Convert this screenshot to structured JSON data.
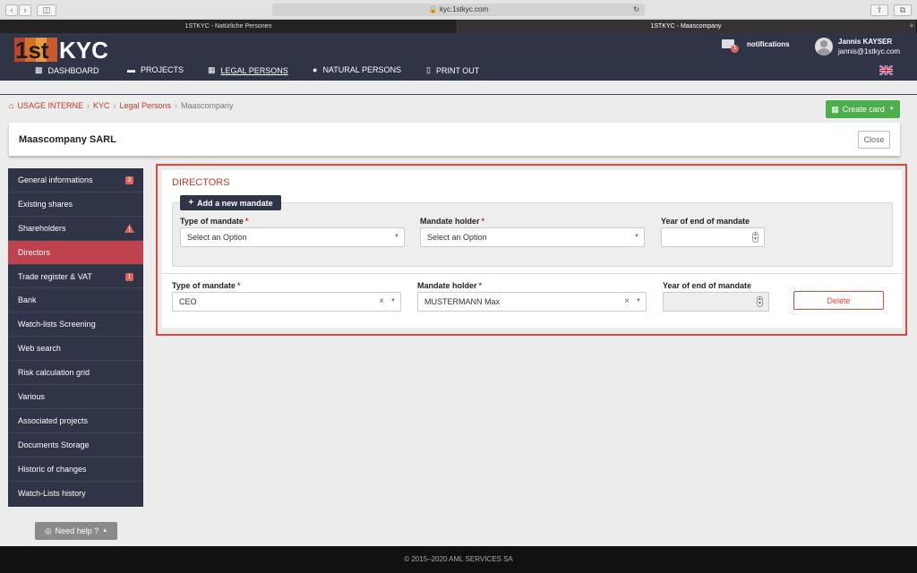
{
  "browser": {
    "url": "kyc.1stkyc.com",
    "tabs": [
      {
        "label": "1STKYC - Natürliche Personen",
        "active": false
      },
      {
        "label": "1STKYC - Maascompany",
        "active": true
      }
    ]
  },
  "header": {
    "logo_text": "1stKYC",
    "notifications_label": "notifications",
    "notification_count": "1",
    "user_name": "Jannis KAYSER",
    "user_email": "jannis@1stkyc.com"
  },
  "nav": {
    "items": [
      {
        "label": "DASHBOARD",
        "icon": "bar-chart-icon"
      },
      {
        "label": "PROJECTS",
        "icon": "folder-icon"
      },
      {
        "label": "LEGAL PERSONS",
        "icon": "building-icon",
        "active": true
      },
      {
        "label": "NATURAL PERSONS",
        "icon": "user-icon"
      },
      {
        "label": "PRINT OUT",
        "icon": "document-icon"
      }
    ],
    "language": "en"
  },
  "breadcrumb": {
    "items": [
      "USAGE INTERNE",
      "KYC",
      "Legal Persons"
    ],
    "current": "Maascompany"
  },
  "create_card_label": "Create card",
  "card": {
    "title": "Maascompany SARL",
    "close_label": "Close"
  },
  "sidebar": {
    "items": [
      {
        "label": "General informations",
        "badge": "3"
      },
      {
        "label": "Existing shares"
      },
      {
        "label": "Shareholders",
        "warning": true
      },
      {
        "label": "Directors",
        "active": true
      },
      {
        "label": "Trade register & VAT",
        "badge": "1"
      },
      {
        "label": "Bank"
      },
      {
        "label": "Watch-lists Screening"
      },
      {
        "label": "Web search"
      },
      {
        "label": "Risk calculation grid"
      },
      {
        "label": "Various"
      },
      {
        "label": "Associated projects"
      },
      {
        "label": "Documents Storage"
      },
      {
        "label": "Historic of changes"
      },
      {
        "label": "Watch-Lists history"
      }
    ]
  },
  "help_label": "Need help ?",
  "directors": {
    "section_title": "DIRECTORS",
    "add_button_label": "Add a new mandate",
    "new_form": {
      "type_label": "Type of mandate",
      "type_value": "Select an Option",
      "holder_label": "Mandate holder",
      "holder_value": "Select an Option",
      "year_label": "Year of end of mandate",
      "year_value": ""
    },
    "existing": {
      "type_label": "Type of mandate",
      "type_value": "CEO",
      "holder_label": "Mandate holder",
      "holder_value": "MUSTERMANN Max",
      "year_label": "Year of end of mandate",
      "year_value": "",
      "delete_label": "Delete"
    },
    "required_marker": "*"
  },
  "footer_text": "© 2015–2020 AML SERVICES SA",
  "colors": {
    "header_bg": "#2f3446",
    "accent_red": "#c0392b",
    "active_sidebar": "#c0424e",
    "green": "#4cae4c",
    "panel_border": "#e8453c"
  }
}
